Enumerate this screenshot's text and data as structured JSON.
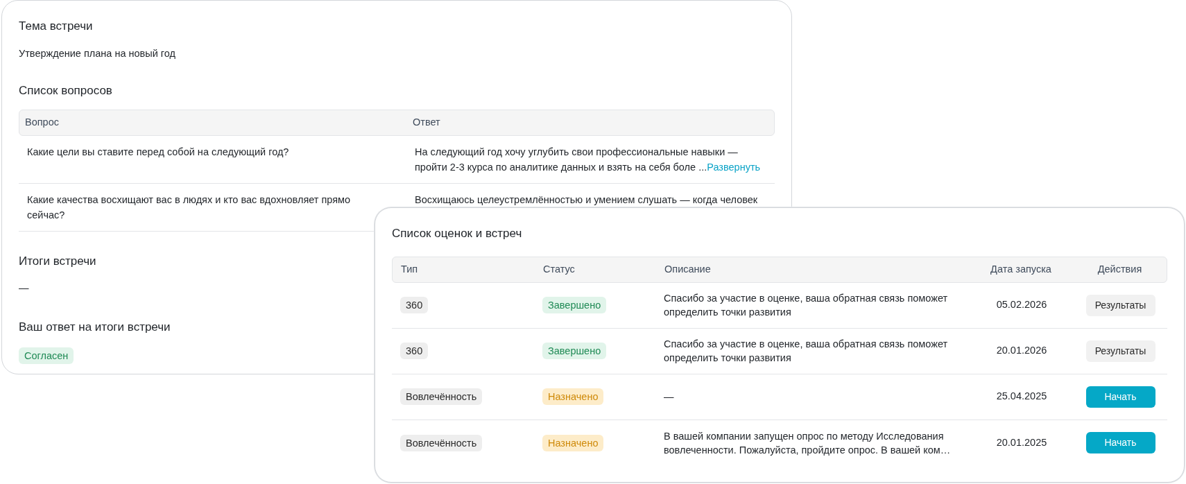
{
  "meeting_card": {
    "topic_title": "Тема встречи",
    "topic_value": "Утверждение плана на новый год",
    "questions_title": "Список вопросов",
    "questions_table": {
      "columns": [
        "Вопрос",
        "Ответ"
      ],
      "rows": [
        {
          "question": "Какие цели вы ставите перед собой на следующий год?",
          "answer": "На следующий год хочу углубить свои профессиональные навыки — пройти 2-3 курса по аналитике данных и взять на себя боле ...",
          "expand_link": "Развернуть"
        },
        {
          "question": "Какие качества восхищают вас в людях и кто вас вдохновляет прямо сейчас?",
          "answer": "Восхищаюсь целеустремлённостью и умением слушать — когда человек"
        }
      ]
    },
    "results_title": "Итоги встречи",
    "results_value": "—",
    "response_title": "Ваш ответ на итоги встречи",
    "response_badge": "Согласен"
  },
  "assessments_card": {
    "title": "Список оценок и встреч",
    "columns": [
      "Тип",
      "Статус",
      "Описание",
      "Дата запуска",
      "Действия"
    ],
    "rows": [
      {
        "type": "360",
        "status": {
          "label": "Завершено",
          "kind": "success"
        },
        "description": "Спасибо за участие в оценке, ваша обратная связь поможет определить точки развития",
        "date": "05.02.2026",
        "action": {
          "label": "Результаты",
          "kind": "secondary"
        }
      },
      {
        "type": "360",
        "status": {
          "label": "Завершено",
          "kind": "success"
        },
        "description": "Спасибо за участие в оценке, ваша обратная связь поможет определить точки развития",
        "date": "20.01.2026",
        "action": {
          "label": "Результаты",
          "kind": "secondary"
        }
      },
      {
        "type": "Вовлечённость",
        "status": {
          "label": "Назначено",
          "kind": "warning"
        },
        "description": "—",
        "date": "25.04.2025",
        "action": {
          "label": "Начать",
          "kind": "primary"
        }
      },
      {
        "type": "Вовлечённость",
        "status": {
          "label": "Назначено",
          "kind": "warning"
        },
        "description": "В вашей компании запущен опрос по методу Исследования вовлеченности. Пожалуйста, пройдите опрос. В вашей ком…",
        "date": "20.01.2025",
        "action": {
          "label": "Начать",
          "kind": "primary"
        }
      }
    ]
  }
}
